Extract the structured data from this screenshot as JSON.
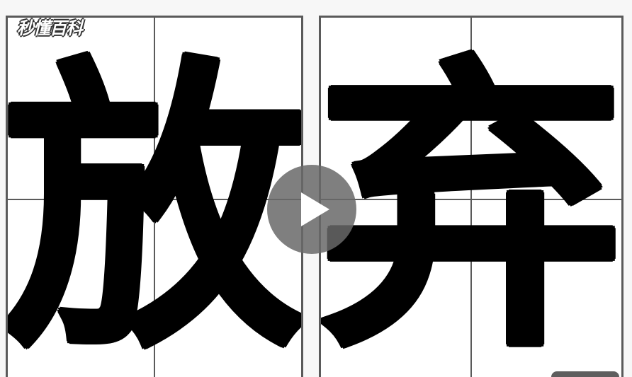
{
  "video": {
    "logo_text": "秒懂百科",
    "characters": [
      "放",
      "弃"
    ],
    "play_icon": "play-triangle-icon"
  },
  "colors": {
    "ink": "#000000",
    "grid": "#5a5a5a",
    "play_overlay": "#696969"
  }
}
